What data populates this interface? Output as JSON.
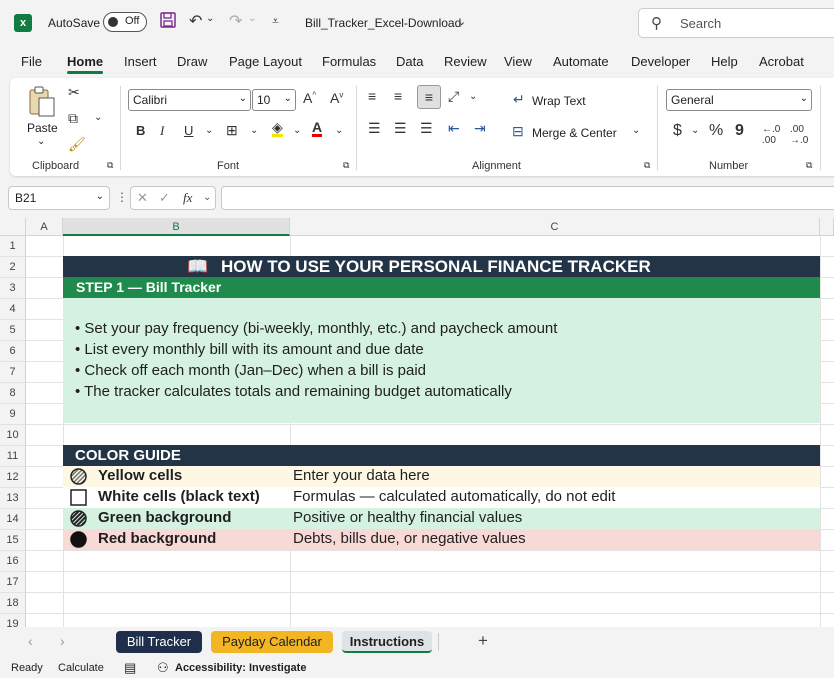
{
  "titlebar": {
    "autosave_label": "AutoSave",
    "autosave_state": "Off",
    "filename": "Bill_Tracker_Excel-Download",
    "search_placeholder": "Search"
  },
  "ribbon_tabs": [
    "File",
    "Home",
    "Insert",
    "Draw",
    "Page Layout",
    "Formulas",
    "Data",
    "Review",
    "View",
    "Automate",
    "Developer",
    "Help",
    "Acrobat"
  ],
  "active_tab": "Home",
  "ribbon": {
    "clipboard": {
      "paste_label": "Paste",
      "group_label": "Clipboard"
    },
    "font": {
      "font_name": "Calibri",
      "font_size": "10",
      "group_label": "Font",
      "bold": "B",
      "italic": "I",
      "underline": "U"
    },
    "alignment": {
      "wrap_text": "Wrap Text",
      "merge_center": "Merge & Center",
      "group_label": "Alignment"
    },
    "number": {
      "format": "General",
      "group_label": "Number",
      "currency": "$",
      "percent": "%",
      "comma": "9"
    }
  },
  "formula_bar": {
    "name_box": "B21",
    "fx_label": "fx",
    "value": ""
  },
  "columns": [
    "A",
    "B",
    "C"
  ],
  "rows": [
    "1",
    "2",
    "3",
    "4",
    "5",
    "6",
    "7",
    "8",
    "9",
    "10",
    "11",
    "12",
    "13",
    "14",
    "15",
    "16",
    "17",
    "18",
    "19"
  ],
  "sheet": {
    "title": "HOW TO USE YOUR PERSONAL FINANCE TRACKER",
    "step1_header": "STEP 1  —  Bill Tracker",
    "step1_bullets": [
      "• Set your pay frequency (bi-weekly, monthly, etc.) and paycheck amount",
      "• List every monthly bill with its amount and due date",
      "• Check off each month (Jan–Dec) when a bill is paid",
      "• The tracker calculates totals and remaining budget automatically"
    ],
    "color_guide_header": "COLOR GUIDE",
    "color_guide": [
      {
        "label": "Yellow cells",
        "desc": "Enter your data here",
        "bg": "#fdf7e4",
        "icon": "hatched-circle-icon"
      },
      {
        "label": "White cells (black text)",
        "desc": "Formulas — calculated automatically, do not edit",
        "bg": "#ffffff",
        "icon": "white-square-icon"
      },
      {
        "label": "Green background",
        "desc": "Positive or healthy financial values",
        "bg": "#d4f1e1",
        "icon": "dark-hatched-circle-icon"
      },
      {
        "label": "Red background",
        "desc": "Debts, bills due, or negative values",
        "bg": "#f9d9d6",
        "icon": "black-circle-icon"
      }
    ]
  },
  "sheet_tabs": [
    {
      "label": "Bill Tracker",
      "bg": "#1f2f4b",
      "color": "#ffffff"
    },
    {
      "label": "Payday Calendar",
      "bg": "#f2b624",
      "color": "#1f1f1f"
    },
    {
      "label": "Instructions",
      "bg": "#dde3e6",
      "color": "#1f1f1f"
    }
  ],
  "status": {
    "ready": "Ready",
    "calculate": "Calculate",
    "accessibility": "Accessibility: Investigate"
  },
  "colors": {
    "title_bg": "#243447",
    "step_bg": "#1f8a4c",
    "step_body_bg": "#d4f1e1",
    "accent": "#107c41"
  }
}
